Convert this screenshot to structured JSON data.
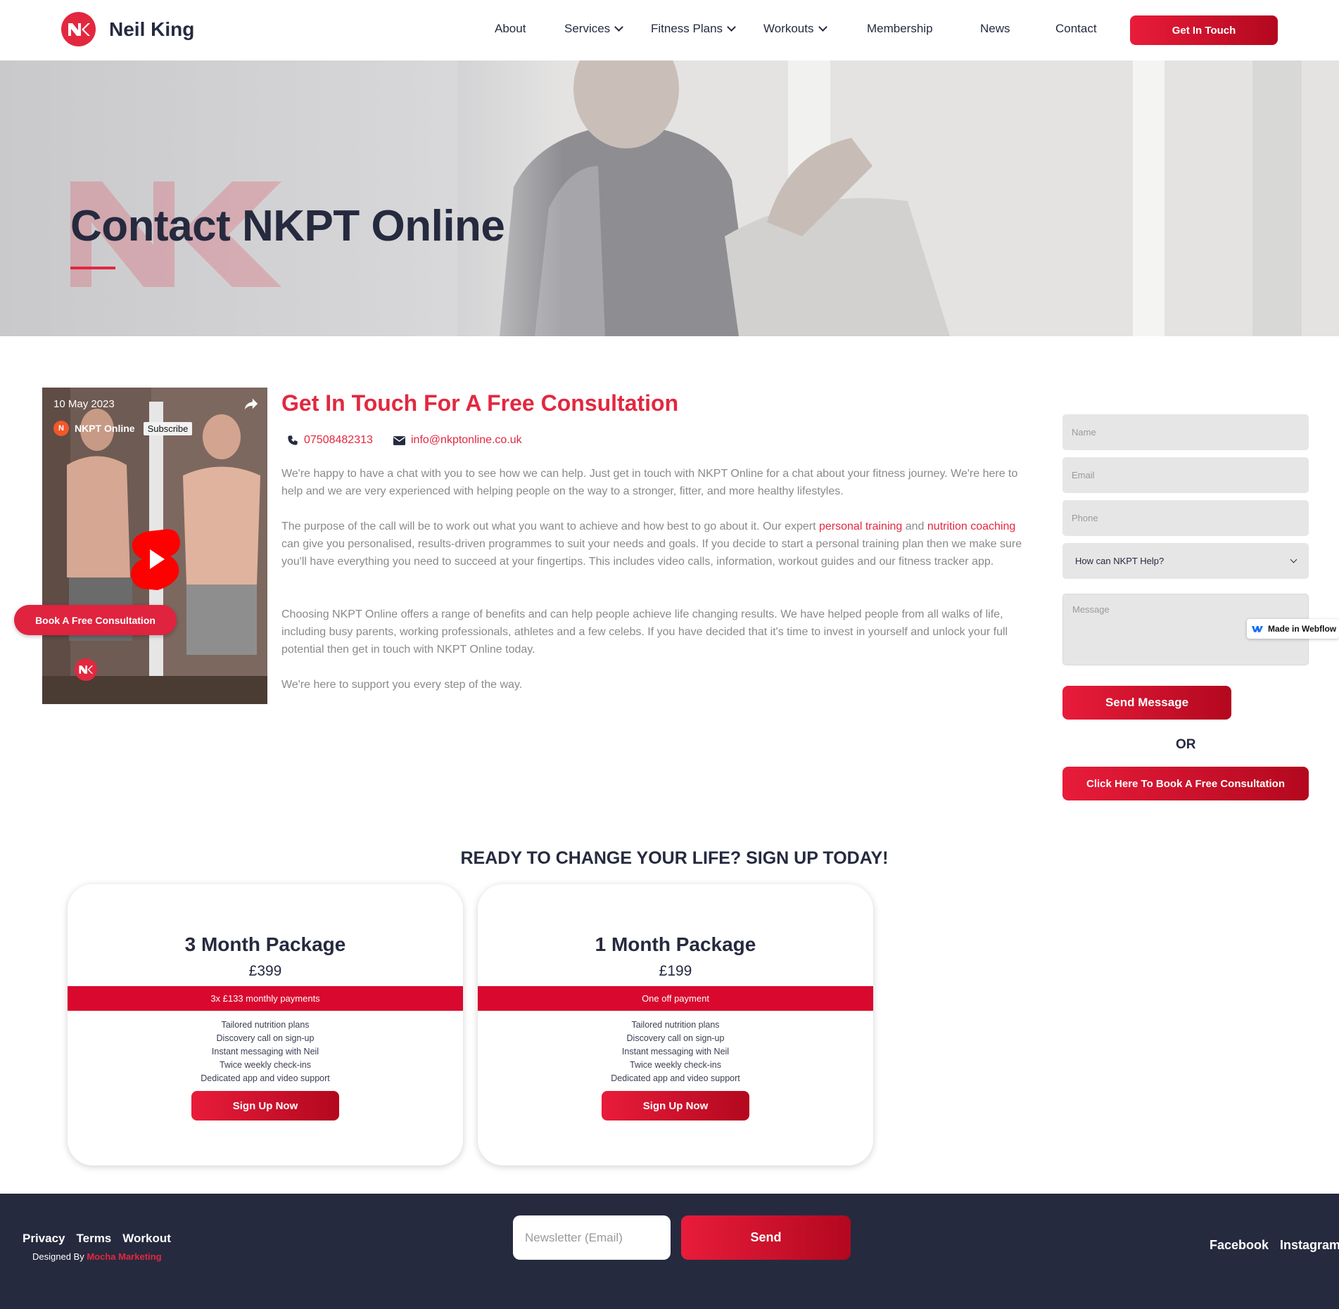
{
  "header": {
    "brand": "Neil King",
    "nav": [
      {
        "label": "About",
        "dropdown": false
      },
      {
        "label": "Services",
        "dropdown": true
      },
      {
        "label": "Fitness Plans",
        "dropdown": true
      },
      {
        "label": "Workouts",
        "dropdown": true
      },
      {
        "label": "Membership",
        "dropdown": false
      },
      {
        "label": "News",
        "dropdown": false
      },
      {
        "label": "Contact",
        "dropdown": false
      }
    ],
    "cta": "Get In Touch"
  },
  "hero": {
    "title": "Contact NKPT Online"
  },
  "video": {
    "date": "10 May 2023",
    "channel_initial": "N",
    "channel": "NKPT Online",
    "subscribe": "Subscribe"
  },
  "floating_cta": "Book A Free Consultation",
  "contact": {
    "title": "Get In Touch For A Free Consultation",
    "phone": "07508482313",
    "email": "info@nkptonline.co.uk",
    "p1": "We're happy to have a chat with you to see how we can help. Just get in touch with NKPT Online for a chat about your fitness journey. We're here to help and we are very experienced with helping people on the way to a stronger, fitter, and more healthy lifestyles.",
    "p2_before": "The purpose of the call will be to work out what you want to achieve and how best to go about it. Our expert ",
    "p2_link1": "personal training",
    "p2_mid": " and ",
    "p2_link2": "nutrition coaching",
    "p2_after": " can give you personalised, results-driven programmes to suit your needs and goals. If you decide to start a personal training plan then we make sure you'll have everything you need to succeed at your fingertips. This includes video calls, information, workout guides and our fitness tracker app.",
    "p3": "Choosing NKPT Online offers a range of benefits and can help people achieve life changing results. We have helped people from all walks of life, including busy parents, working professionals, athletes and a few celebs. If you have decided that it's time to invest in yourself and unlock your full potential then get in touch with NKPT Online today.",
    "p4": "We're here to support you every step of the way."
  },
  "form": {
    "name_placeholder": "Name",
    "email_placeholder": "Email",
    "phone_placeholder": "Phone",
    "help_select": "How can NKPT Help?",
    "message_placeholder": "Message",
    "send": "Send Message",
    "or": "OR",
    "book": "Click Here To Book A Free Consultation"
  },
  "webflow_badge": "Made in Webflow",
  "packages": {
    "heading": "READY TO CHANGE YOUR LIFE? SIGN UP TODAY!",
    "items": [
      {
        "title": "3 Month Package",
        "price": "£399",
        "band": "3x £133 monthly payments",
        "features": [
          "Tailored nutrition plans",
          "Discovery call on sign-up",
          "Instant messaging with Neil",
          "Twice weekly check-ins",
          "Dedicated app and video support"
        ],
        "button": "Sign Up Now"
      },
      {
        "title": "1 Month Package",
        "price": "£199",
        "band": "One off payment",
        "features": [
          "Tailored nutrition plans",
          "Discovery call on sign-up",
          "Instant messaging with Neil",
          "Twice weekly check-ins",
          "Dedicated app and video support"
        ],
        "button": "Sign Up Now"
      }
    ]
  },
  "footer": {
    "links": [
      "Privacy",
      "Terms",
      "Workout"
    ],
    "designed_by": "Designed By",
    "designer": "Mocha Marketing",
    "newsletter_placeholder": "Newsletter (Email)",
    "send": "Send",
    "social": [
      "Facebook",
      "Instagram"
    ]
  },
  "colors": {
    "accent": "#e2283f",
    "navy": "#262a3f",
    "band": "#d9082e"
  }
}
